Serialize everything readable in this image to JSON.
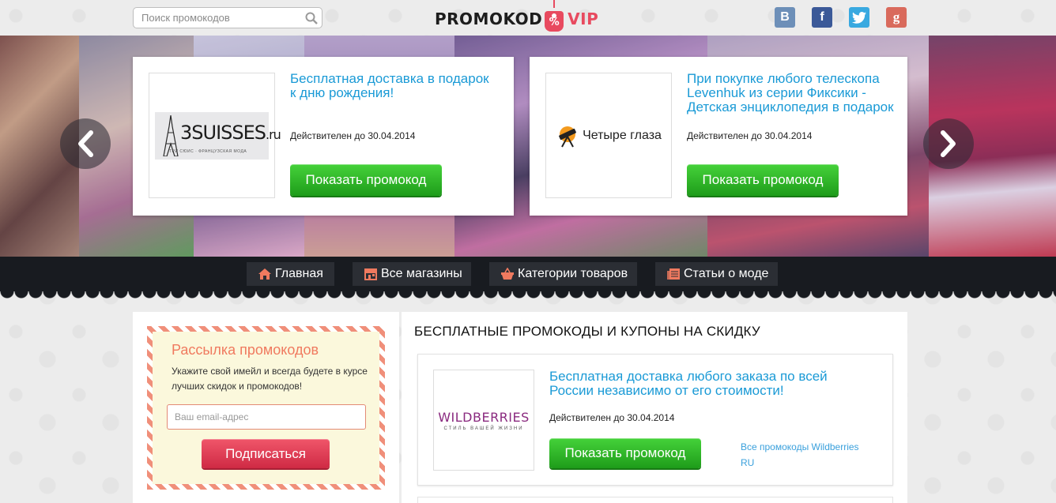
{
  "header": {
    "search_placeholder": "Поиск промокодов",
    "logo": {
      "word1": "PROMOKOD",
      "badge": "%",
      "word2": "VIP"
    },
    "socials": [
      {
        "name": "vkontakte",
        "glyph": "B",
        "color": "#6d8fb8"
      },
      {
        "name": "facebook",
        "glyph": "f",
        "color": "#3b5998"
      },
      {
        "name": "twitter",
        "glyph": "twitter-bird",
        "color": "#39a9e0"
      },
      {
        "name": "google-plus",
        "glyph": "g",
        "color": "#d96a5c"
      }
    ]
  },
  "slider": {
    "slides": [
      {
        "brand": {
          "name": "3SUISSES",
          "suffix": ".ru",
          "tagline": "ТРИ СЮИС · ФРАНЦУЗСКАЯ МОДА"
        },
        "title": "Бесплатная доставка в подарок к дню рождения!",
        "valid": "Действителен до 30.04.2014",
        "button": "Показать промокод"
      },
      {
        "brand": {
          "name": "Четыре глаза"
        },
        "title": "При покупке любого телескопа Levenhuk из серии Фиксики - Детская энциклопедия в подарок",
        "valid": "Действителен до 30.04.2014",
        "button": "Показать промокод"
      }
    ]
  },
  "nav": [
    {
      "label": "Главная",
      "icon": "home-icon"
    },
    {
      "label": "Все магазины",
      "icon": "store-icon"
    },
    {
      "label": "Категории товаров",
      "icon": "basket-icon"
    },
    {
      "label": "Статьи о моде",
      "icon": "articles-icon"
    }
  ],
  "newsletter": {
    "title": "Рассылка промокодов",
    "text": "Укажите свой имейл и всегда будете в курсе лучших скидок и промокодов!",
    "placeholder": "Ваш email-адрес",
    "button": "Подписаться"
  },
  "main": {
    "heading": "БЕСПЛАТНЫЕ ПРОМОКОДЫ И КУПОНЫ НА СКИДКУ",
    "coupons": [
      {
        "brand": {
          "name": "WILDBERRIES",
          "tagline": "СТИЛЬ ВАШЕЙ ЖИЗНИ"
        },
        "title": "Бесплатная доставка любого заказа по всей России независимо от его стоимости!",
        "valid": "Действителен до 30.04.2014",
        "button": "Показать промокод",
        "store_link": "Все промокоды Wildberries RU"
      }
    ]
  },
  "colors": {
    "accent_blue": "#1a9ad6",
    "green_button": "#2fb828",
    "red_button": "#e03f56",
    "logo_red": "#e84a5f",
    "nav_bg": "#181b20"
  }
}
